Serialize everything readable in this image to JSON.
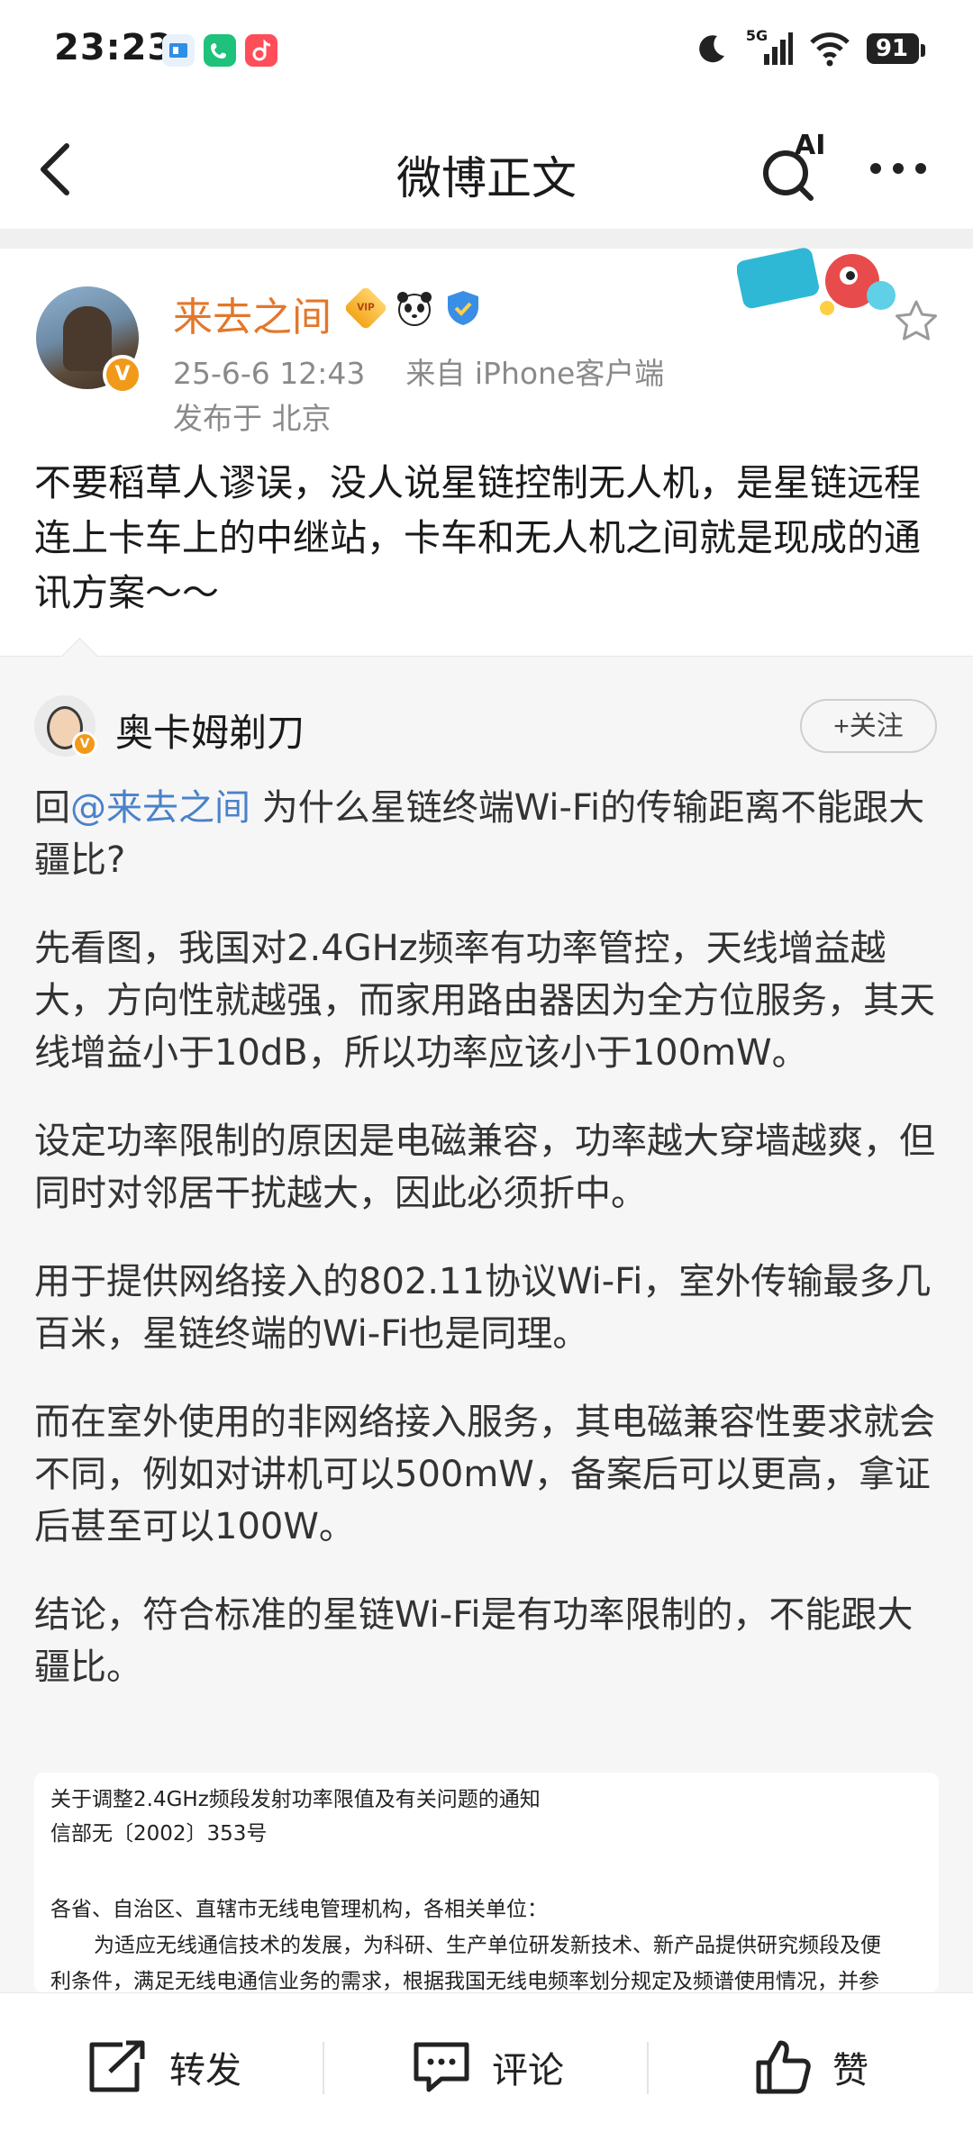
{
  "status_bar": {
    "time": "23:23",
    "network": "5G",
    "battery": "91"
  },
  "nav": {
    "title": "微博正文",
    "ai_label": "AI"
  },
  "post": {
    "author": "来去之间",
    "vip_label": "VIP",
    "verified_mark": "V",
    "timestamp": "25-6-6 12:43",
    "source": "来自 iPhone客户端",
    "location": "发布于 北京",
    "text": "不要稻草人谬误，没人说星链控制无人机，是星链远程连上卡车上的中继站，卡车和无人机之间就是现成的通讯方案～～"
  },
  "quoted": {
    "author": "奥卡姆剃刀",
    "follow_label": "+关注",
    "reply_prefix": "回",
    "mention": "@来去之间",
    "first_line_rest": " 为什么星链终端Wi-Fi的传输距离不能跟大疆比?",
    "paragraphs": [
      "先看图，我国对2.4GHz频率有功率管控，天线增益越大，方向性就越强，而家用路由器因为全方位服务，其天线增益小于10dB，所以功率应该小于100mW。",
      "设定功率限制的原因是电磁兼容，功率越大穿墙越爽，但同时对邻居干扰越大，因此必须折中。",
      "用于提供网络接入的802.11协议Wi-Fi，室外传输最多几百米，星链终端的Wi-Fi也是同理。",
      "而在室外使用的非网络接入服务，其电磁兼容性要求就会不同，例如对讲机可以500mW，备案后可以更高，拿证后甚至可以100W。",
      "结论，符合标准的星链Wi-Fi是有功率限制的，不能跟大疆比。"
    ],
    "image_lines": [
      "关于调整2.4GHz频段发射功率限值及有关问题的通知",
      "信部无〔2002〕353号",
      "各省、自治区、直辖市无线电管理机构，各相关单位：",
      "为适应无线通信技术的发展，为科研、生产单位研发新技术、新产品提供研究频段及便",
      "利条件，满足无线电通信业务的需求，根据我国无线电频率划分规定及频谱使用情况，并参"
    ]
  },
  "bottom_bar": {
    "repost": "转发",
    "comment": "评论",
    "like": "赞"
  },
  "colors": {
    "author_orange": "#e3772b",
    "link_blue": "#4a82c9",
    "meta_gray": "#8a8a8a",
    "quote_bg": "#f6f6f6"
  }
}
